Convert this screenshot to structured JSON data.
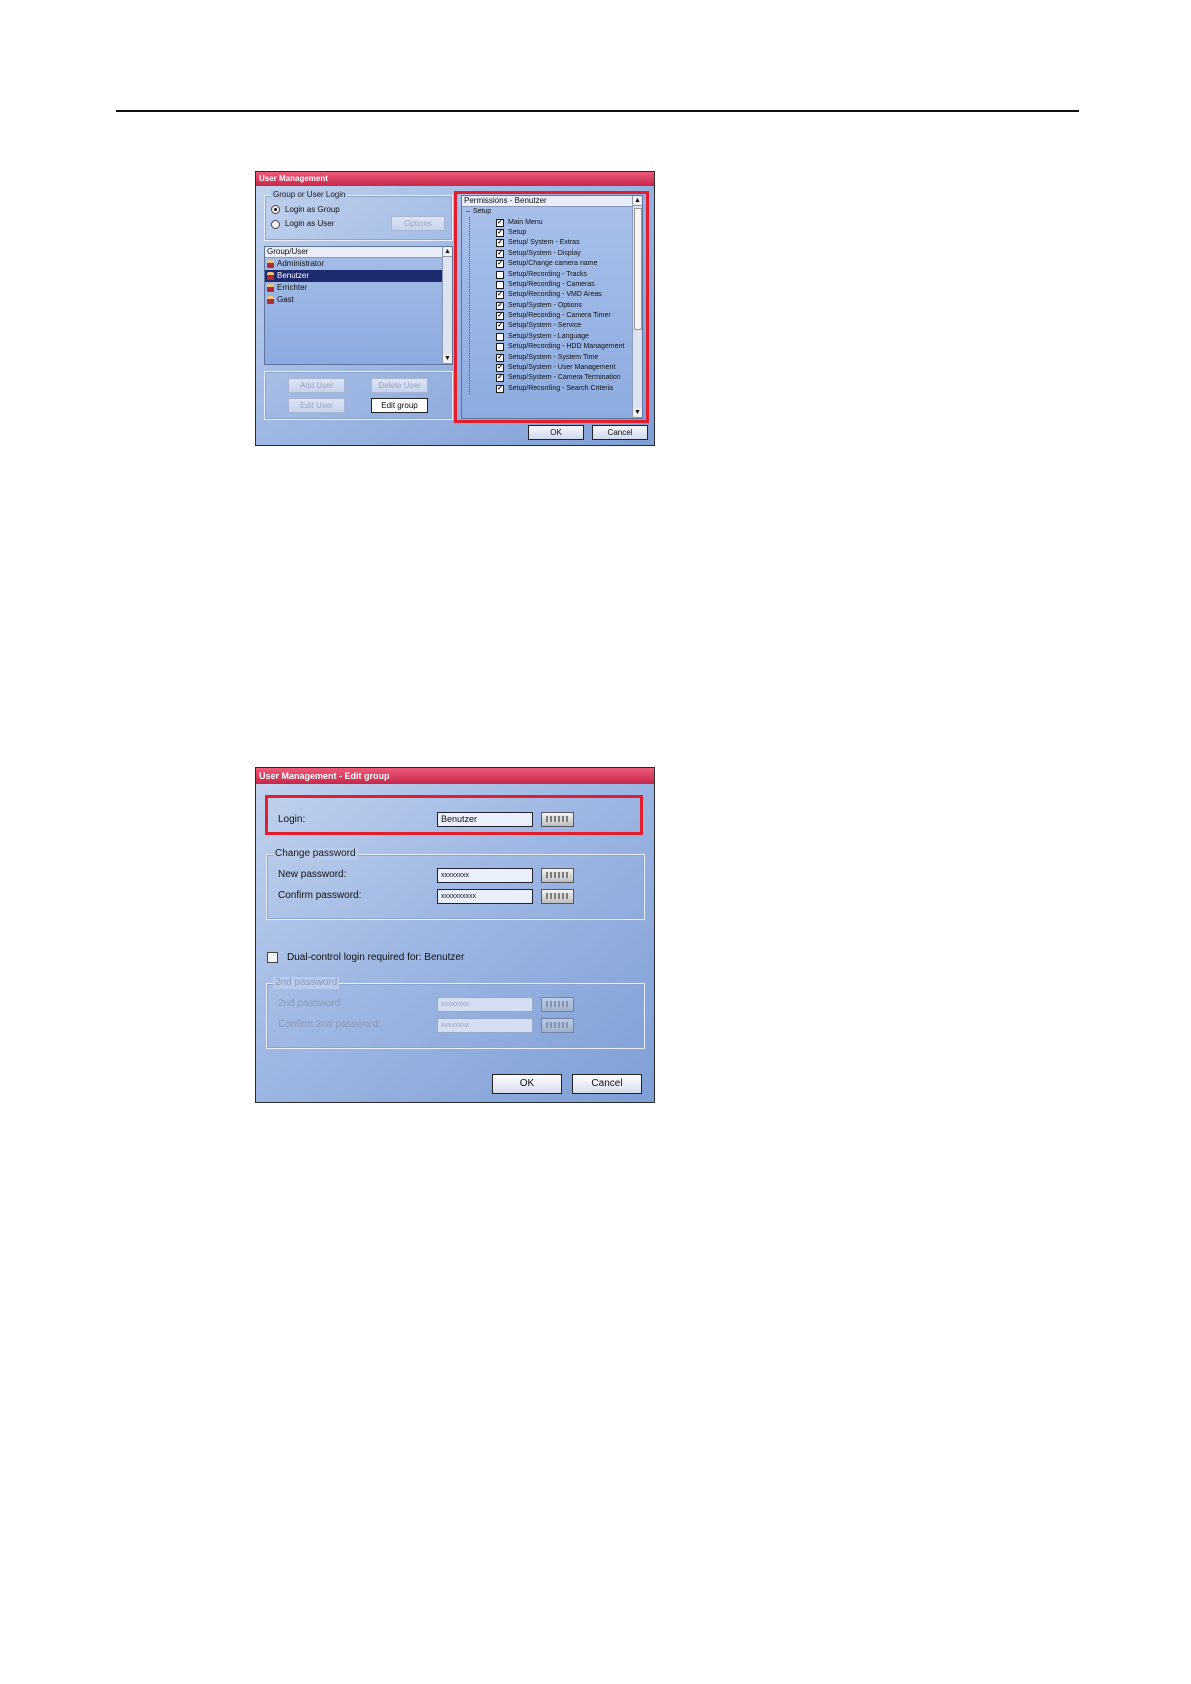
{
  "dialog1": {
    "title": "User Management",
    "login_group_title": "Group or User Login",
    "radio_group_label": "Login as Group",
    "radio_user_label": "Login as User",
    "options_button": "Options",
    "list_header": "Group/User",
    "list_items": [
      "Administrator",
      "Benutzer",
      "Errichter",
      "Gast"
    ],
    "add_user_button": "Add User",
    "delete_user_button": "Delete User",
    "edit_user_button": "Edit User",
    "edit_group_button": "Edit group",
    "permissions_header": "Permissions - Benutzer",
    "setup_node": "Setup",
    "permissions": [
      {
        "label": "Main Menu",
        "checked": true
      },
      {
        "label": "Setup",
        "checked": true
      },
      {
        "label": "Setup/ System - Extras",
        "checked": true
      },
      {
        "label": "Setup/System - Display",
        "checked": true
      },
      {
        "label": "Setup/Change camera name",
        "checked": true
      },
      {
        "label": "Setup/Recording - Tracks",
        "checked": false
      },
      {
        "label": "Setup/Recording - Cameras",
        "checked": false
      },
      {
        "label": "Setup/Recording - VMD Areas",
        "checked": true
      },
      {
        "label": "Setup/System - Options",
        "checked": true
      },
      {
        "label": "Setup/Recording - Camera Timer",
        "checked": true
      },
      {
        "label": "Setup/System - Service",
        "checked": true
      },
      {
        "label": "Setup/System - Language",
        "checked": false
      },
      {
        "label": "Setup/Recording - HDD Management",
        "checked": false
      },
      {
        "label": "Setup/System - System Time",
        "checked": true
      },
      {
        "label": "Setup/System - User Management",
        "checked": true
      },
      {
        "label": "Setup/System - Camera Termination",
        "checked": true
      },
      {
        "label": "Setup/Recording - Search Criteria",
        "checked": true
      }
    ],
    "ok_button": "OK",
    "cancel_button": "Cancel"
  },
  "dialog2": {
    "title": "User Management - Edit group",
    "login_label": "Login:",
    "login_value": "Benutzer",
    "change_password_title": "Change password",
    "new_password_label": "New password:",
    "new_password_value": "xxxxxxxx",
    "confirm_password_label": "Confirm password:",
    "confirm_password_value": "xxxxxxxxxx",
    "dual_control_label": "Dual-control login required for: Benutzer",
    "second_password_title": "2nd password",
    "second_password_label": "2nd password:",
    "second_password_value": "xxxxxxxx",
    "confirm_second_label": "Confirm 2nd password:",
    "confirm_second_value": "xxxxxxxx",
    "ok_button": "OK",
    "cancel_button": "Cancel"
  },
  "colors": {
    "title_bar": "#c7264b",
    "highlight_frame": "#e01e2c",
    "window_bg": "#9fb7e3",
    "selection": "#1e2a6e"
  }
}
